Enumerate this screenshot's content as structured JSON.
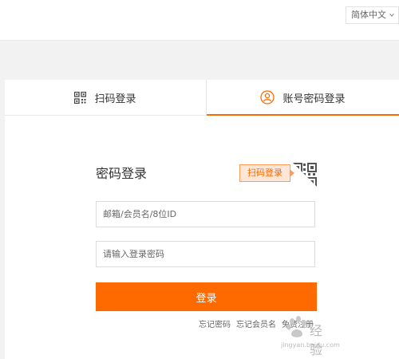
{
  "header": {
    "language": {
      "selected": "简体中文",
      "icon": "chevron-down-icon"
    }
  },
  "tabs": [
    {
      "label": "扫码登录",
      "icon": "qr-code-icon",
      "active": false
    },
    {
      "label": "账号密码登录",
      "icon": "user-icon",
      "active": true
    }
  ],
  "form": {
    "title": "密码登录",
    "qr_tip": "扫码登录",
    "username": {
      "placeholder": "邮箱/会员名/8位ID",
      "value": ""
    },
    "password": {
      "placeholder": "请输入登录密码",
      "value": ""
    },
    "submit_label": "登录",
    "links": [
      {
        "label": "忘记密码"
      },
      {
        "label": "忘记会员名"
      },
      {
        "label": "免费注册"
      }
    ]
  },
  "watermark": {
    "text": "经验",
    "url": "jingyan.baidu.com"
  },
  "colors": {
    "accent": "#ff6a00",
    "tip_bg": "#ffe6d6",
    "page_bg": "#f2f2f2"
  }
}
